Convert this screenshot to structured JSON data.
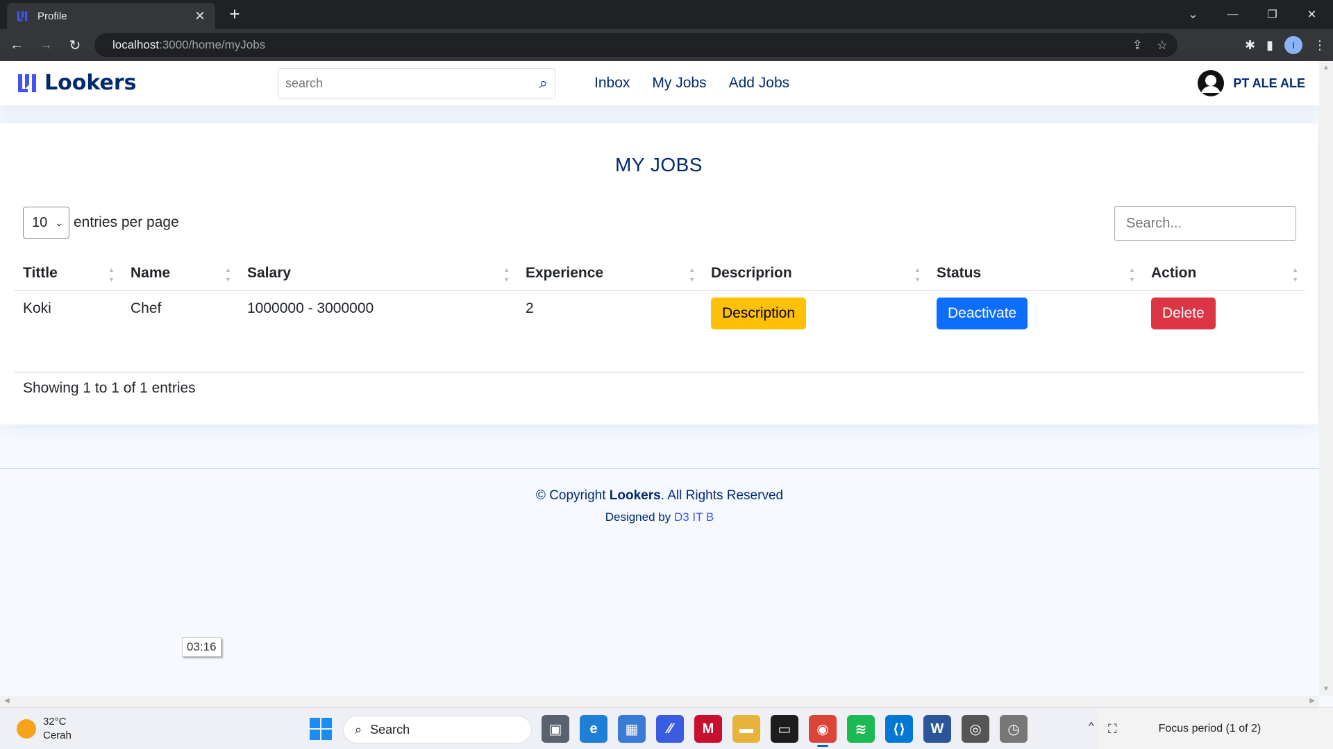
{
  "browser": {
    "tab_title": "Profile",
    "url_host": "localhost",
    "url_rest": ":3000/home/myJobs",
    "profile_initial": "I"
  },
  "site": {
    "logo_text": "Lookers",
    "search_placeholder": "search",
    "nav": [
      "Inbox",
      "My Jobs",
      "Add Jobs"
    ],
    "user_name": "PT ALE ALE"
  },
  "page": {
    "title": "MY JOBS",
    "per_page_value": "10",
    "per_page_label": "entries per page",
    "table_search_placeholder": "Search...",
    "columns": [
      "Tittle",
      "Name",
      "Salary",
      "Experience",
      "Descriprion",
      "Status",
      "Action"
    ],
    "rows": [
      {
        "title": "Koki",
        "name": "Chef",
        "salary": "1000000 - 3000000",
        "experience": "2",
        "description_btn": "Description",
        "status_btn": "Deactivate",
        "action_btn": "Delete"
      }
    ],
    "info": "Showing 1 to 1 of 1 entries"
  },
  "footer": {
    "copy_pre": "© Copyright ",
    "copy_brand": "Lookers",
    "copy_post": ". All Rights Reserved",
    "designed_pre": "Designed by ",
    "designed_link": "D3 IT B"
  },
  "timer": "03:16",
  "taskbar": {
    "temp": "32°C",
    "weather": "Cerah",
    "search": "Search",
    "focus": "Focus period (1 of 2)"
  },
  "colors": {
    "brand": "#012970",
    "warning": "#ffc107",
    "primary": "#0d6efd",
    "danger": "#dc3545"
  }
}
